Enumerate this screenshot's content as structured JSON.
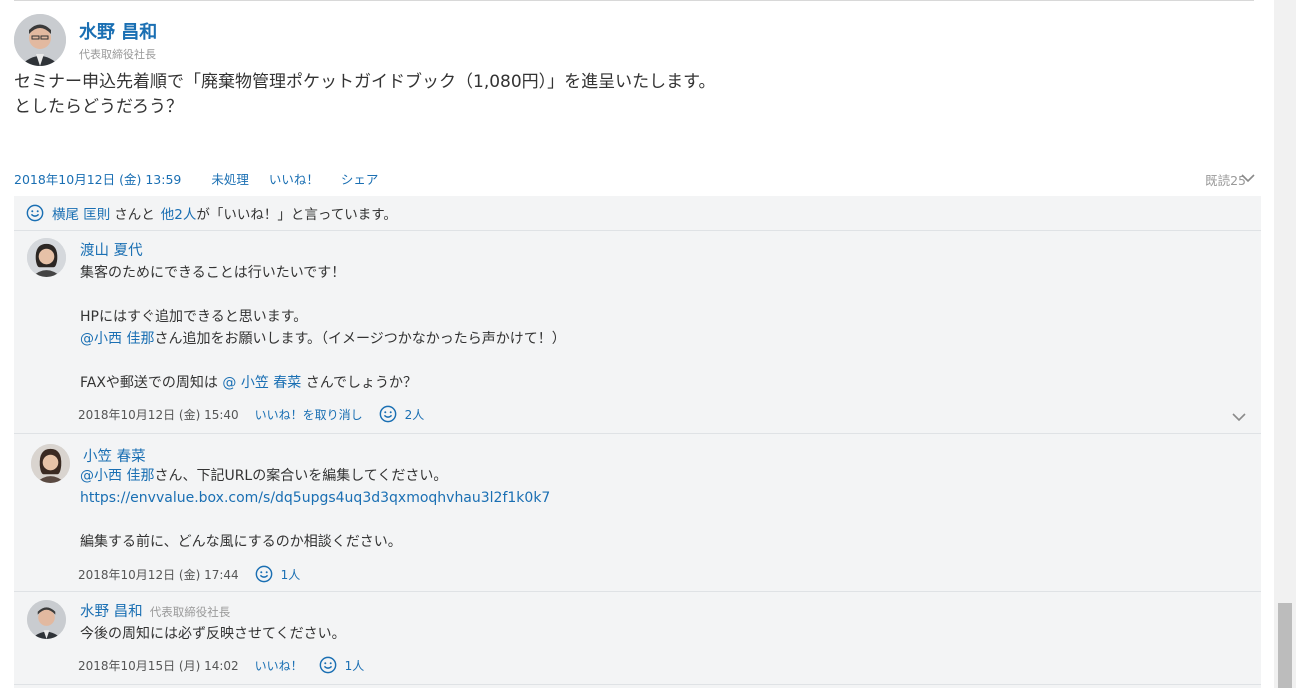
{
  "post": {
    "author_name": "水野 昌和",
    "author_role": "代表取締役社長",
    "text_lines": [
      "セミナー申込先着順で「廃棄物管理ポケットガイドブック（1,080円）」を進呈いたします。",
      "としたらどうだろう？"
    ],
    "timestamp": "2018年10月12日 (金) 13:59",
    "actions": {
      "unprocessed": "未処理",
      "like": "いいね！",
      "share": "シェア"
    },
    "read_count": "既読25",
    "likes_summary": {
      "liker": "横尾 匡則",
      "mid": "さんと",
      "others": "他2人",
      "tail": "が「いいね！」と言っています。"
    }
  },
  "comments": [
    {
      "author_name": "渡山 夏代",
      "lines": [
        "集客のためにできることは行いたいです！",
        "",
        "HPにはすぐ追加できると思います。",
        "@小西 佳那|さん追加をお願いします。（イメージつかなかったら声かけて！）",
        "",
        "FAXや郵送での周知は |@ 小笠 春菜| さんでしょうか？"
      ],
      "mention1": "@小西 佳那",
      "line4_rest": "さん追加をお願いします。（イメージつかなかったら声かけて！）",
      "line6_pre": "FAXや郵送での周知は ",
      "mention2": "@ 小笠 春菜",
      "line6_post": " さんでしょうか？",
      "timestamp": "2018年10月12日 (金) 15:40",
      "like_action": "いいね！を取り消し",
      "like_count": "2人"
    },
    {
      "author_name": "小笠 春菜",
      "mention": "@小西 佳那",
      "line1_rest": "さん、下記URLの案合いを編集してください。",
      "url": "https://envvalue.box.com/s/dq5upgs4uq3d3qxmoqhvhau3l2f1k0k7",
      "line4": "編集する前に、どんな風にするのか相談ください。",
      "timestamp": "2018年10月12日 (金) 17:44",
      "like_count": "1人"
    },
    {
      "author_name": "水野 昌和",
      "author_role": "代表取締役社長",
      "line1": "今後の周知には必ず反映させてください。",
      "timestamp": "2018年10月15日 (月) 14:02",
      "like_action": "いいね！",
      "like_count": "1人"
    }
  ],
  "colors": {
    "link": "#1a6fb3",
    "comment_bg": "#f3f4f5",
    "muted": "#999999"
  }
}
